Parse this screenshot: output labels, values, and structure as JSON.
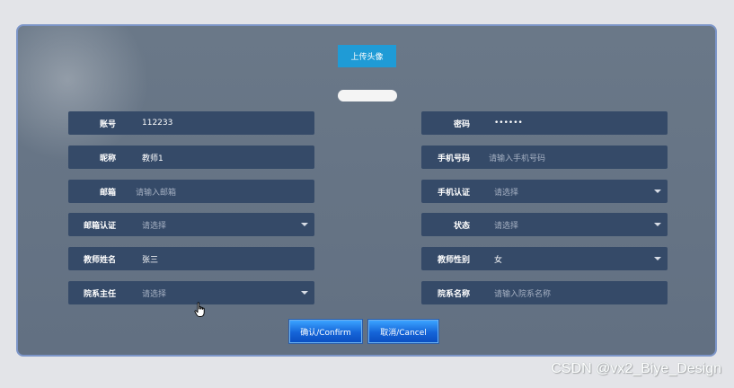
{
  "upload_button": "上传头像",
  "fields": {
    "account": {
      "label": "账号",
      "value": "112233"
    },
    "password": {
      "label": "密码",
      "value": "••••••"
    },
    "nickname": {
      "label": "昵称",
      "value": "教师1"
    },
    "phone": {
      "label": "手机号码",
      "placeholder": "请输入手机号码"
    },
    "email": {
      "label": "邮箱",
      "placeholder": "请输入邮箱"
    },
    "phone_verify": {
      "label": "手机认证",
      "placeholder": "请选择"
    },
    "email_verify": {
      "label": "邮箱认证",
      "placeholder": "请选择"
    },
    "status": {
      "label": "状态",
      "placeholder": "请选择"
    },
    "teacher_name": {
      "label": "教师姓名",
      "value": "张三"
    },
    "gender": {
      "label": "教师性别",
      "value": "女"
    },
    "dept_head": {
      "label": "院系主任",
      "placeholder": "请选择"
    },
    "dept_name": {
      "label": "院系名称",
      "placeholder": "请输入院系名称"
    }
  },
  "buttons": {
    "confirm": "确认/Confirm",
    "cancel": "取消/Cancel"
  },
  "watermark": "CSDN @vx2_Biye_Design"
}
